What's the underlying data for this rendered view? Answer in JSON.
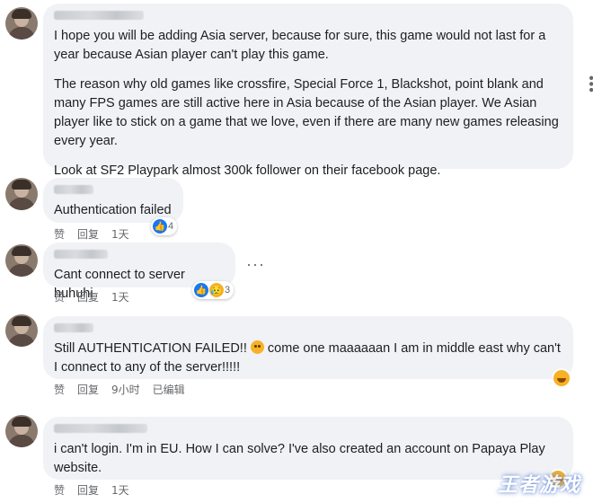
{
  "comments": [
    {
      "paragraphs": [
        "I hope you will be adding Asia server, because for sure, this game would not last for a year because Asian player can't play this game.",
        "The reason why old games like crossfire, Special Force 1, Blackshot, point blank and many FPS games are still active here in Asia because of the Asian player. We Asian player like to stick on a game that we love, even if there are many new games releasing every year.",
        "Look at SF2 Playpark almost 300k follower on their facebook page."
      ]
    },
    {
      "text": "Authentication failed",
      "like_label": "赞",
      "reply_label": "回复",
      "time": "1天",
      "reaction_count": "4"
    },
    {
      "text": "Cant connect to server huhuhi",
      "like_label": "赞",
      "reply_label": "回复",
      "time": "1天",
      "reaction_count": "3",
      "more_icon": "more-options-icon"
    },
    {
      "text_before_emoji": "Still AUTHENTICATION FAILED!!",
      "text_after_emoji": "come one maaaaaan I am in middle east why can't I connect to any of the server!!!!!",
      "like_label": "赞",
      "reply_label": "回复",
      "time": "9小时",
      "edited": "已编辑"
    },
    {
      "text": "i can't login. I'm in EU. How I can solve? I've also created an account on Papaya Play website.",
      "like_label": "赞",
      "reply_label": "回复",
      "time": "1天"
    }
  ],
  "watermark": "王者游戏",
  "colors": {
    "bubble": "#f0f2f5",
    "like_blue": "#1877f2",
    "emoji_yellow": "#f7b125",
    "meta_gray": "#65676b"
  }
}
